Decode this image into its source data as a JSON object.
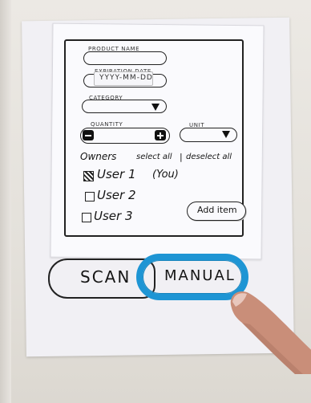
{
  "form": {
    "product_name_label": "Product Name",
    "expiration_date_label": "Expiration Date",
    "expiration_date_placeholder": "YYYY-MM-DD",
    "category_label": "Category",
    "quantity_label": "Quantity",
    "unit_label": "Unit",
    "minus": "−",
    "plus": "+"
  },
  "owners": {
    "title": "Owners",
    "select_all": "select all",
    "separator": "|",
    "deselect_all": "deselect all",
    "users": [
      {
        "label": "User 1",
        "note": "(You)",
        "checked": true
      },
      {
        "label": "User 2",
        "note": "",
        "checked": false
      },
      {
        "label": "User 3",
        "note": "",
        "checked": false
      }
    ],
    "add_item": "Add item"
  },
  "bottom": {
    "scan": "SCAN",
    "manual": "MANUAL",
    "highlight_color": "#1e95d4"
  }
}
